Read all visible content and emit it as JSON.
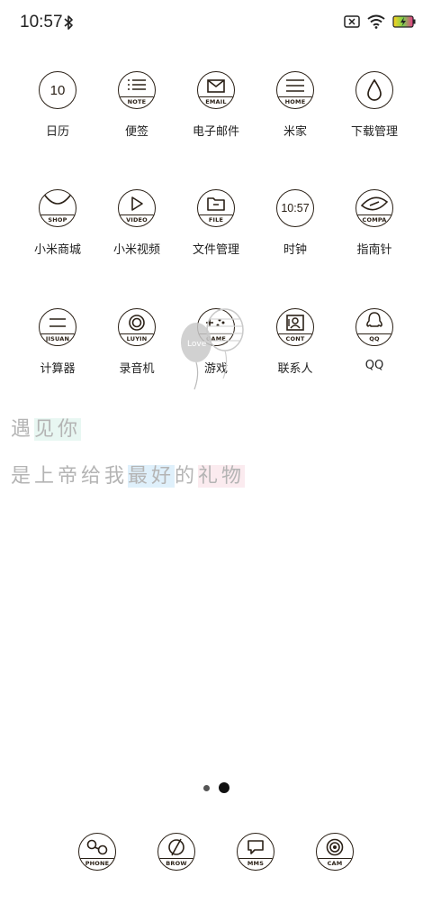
{
  "status": {
    "time": "10:57",
    "icons": [
      "bluetooth-icon",
      "sim-missing-icon",
      "wifi-icon",
      "battery-charging-icon"
    ]
  },
  "home": {
    "rows": [
      [
        {
          "id": "calendar",
          "label": "日历",
          "icon_text": "10",
          "badge": "",
          "icon": "calendar-icon"
        },
        {
          "id": "notes",
          "label": "便签",
          "badge": "NOTE",
          "icon": "list-icon"
        },
        {
          "id": "email",
          "label": "电子邮件",
          "badge": "EMAIL",
          "icon": "envelope-icon"
        },
        {
          "id": "mihome",
          "label": "米家",
          "badge": "HOME",
          "icon": "home-lines-icon"
        },
        {
          "id": "downloads",
          "label": "下载管理",
          "badge": "",
          "icon": "drop-icon"
        }
      ],
      [
        {
          "id": "mi-store",
          "label": "小米商城",
          "badge": "SHOP",
          "icon": "bowl-icon"
        },
        {
          "id": "mi-video",
          "label": "小米视频",
          "badge": "VIDEO",
          "icon": "play-icon"
        },
        {
          "id": "file-manager",
          "label": "文件管理",
          "badge": "FILE",
          "icon": "folder-icon"
        },
        {
          "id": "clock",
          "label": "时钟",
          "icon_text": "10:57",
          "badge": "",
          "icon": "clock-icon"
        },
        {
          "id": "compass",
          "label": "指南针",
          "badge": "COMPA",
          "icon": "compass-eye-icon"
        }
      ],
      [
        {
          "id": "calculator",
          "label": "计算器",
          "badge": "JISUAN",
          "icon": "equals-icon"
        },
        {
          "id": "recorder",
          "label": "录音机",
          "badge": "LUYIN",
          "icon": "record-icon"
        },
        {
          "id": "games",
          "label": "游戏",
          "badge": "GAME",
          "icon": "gamepad-icon"
        },
        {
          "id": "contacts",
          "label": "联系人",
          "badge": "CONT",
          "icon": "contact-card-icon"
        },
        {
          "id": "qq",
          "label": "QQ",
          "badge": "QQ",
          "icon": "penguin-icon"
        }
      ]
    ]
  },
  "widget": {
    "balloon_text": "Love",
    "quote_line1": [
      "遇",
      "见",
      "你"
    ],
    "quote_line2_a": "是上帝给我",
    "quote_line2_b": "最好",
    "quote_line2_c": "的",
    "quote_line2_d": "礼物"
  },
  "pager": {
    "pages": 2,
    "current": 2
  },
  "dock": [
    {
      "id": "phone",
      "badge": "PHONE",
      "icon": "phone-icon"
    },
    {
      "id": "browser",
      "badge": "BROW",
      "icon": "slash-circle-icon"
    },
    {
      "id": "messages",
      "badge": "MMS",
      "icon": "chat-bubble-icon"
    },
    {
      "id": "camera",
      "badge": "CAM",
      "icon": "lens-icon"
    }
  ],
  "colors": {
    "icon_stroke": "#2a2016",
    "quote_gray": "#b4b4b4",
    "mint": "#e8f7f2",
    "blue": "#dff0fb",
    "pink": "#fbebef",
    "battery_accent": "#e93a8a"
  }
}
